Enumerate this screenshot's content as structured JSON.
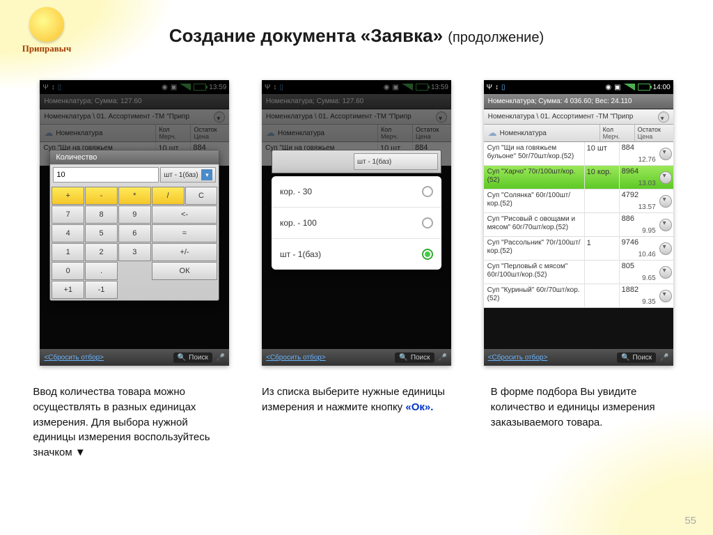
{
  "logo_text": "Приправыч",
  "title_main": "Создание документа «Заявка»",
  "title_cont": "(продолжение)",
  "pagenum": "55",
  "phone1": {
    "time": "13:59",
    "header": "Номенклатура; Сумма: 127.60",
    "breadcrumb": "Номенклатура \\ 01. Ассортимент -ТМ \"Припр",
    "tab_nom": "Номенклатура",
    "tab_kol": "Кол",
    "tab_merch": "Мерч.",
    "tab_ost": "Остаток",
    "tab_price": "Цена",
    "bg_row_name": "Суп \"Щи на говяжьем",
    "bg_row_kol": "10 шт",
    "bg_row_ost": "884",
    "dialog_title": "Количество",
    "input_value": "10",
    "select_label": "шт - 1(баз)",
    "calc_row_ops": [
      "+",
      "-",
      "*",
      "/",
      "C"
    ],
    "calc_r1": [
      "7",
      "8",
      "9",
      "<-"
    ],
    "calc_r2": [
      "4",
      "5",
      "6",
      "="
    ],
    "calc_r3": [
      "1",
      "2",
      "3",
      "+/-"
    ],
    "calc_r4": [
      "0",
      ".",
      "ОК"
    ],
    "calc_extra": [
      "+1",
      "-1"
    ]
  },
  "phone2": {
    "time": "13:59",
    "header": "Номенклатура; Сумма: 127.60",
    "breadcrumb": "Номенклатура \\ 01. Ассортимент -ТМ \"Припр",
    "options": [
      {
        "label": "кор. - 30",
        "sel": false
      },
      {
        "label": "кор. - 100",
        "sel": false
      },
      {
        "label": "шт - 1(баз)",
        "sel": true
      }
    ]
  },
  "phone3": {
    "time": "14:00",
    "header": "Номенклатура; Сумма: 4 036.60; Вес: 24.110",
    "breadcrumb": "Номенклатура \\ 01. Ассортимент -ТМ \"Припр",
    "tab_nom": "Номенклатура",
    "tab_kol": "Кол",
    "tab_merch": "Мерч.",
    "tab_ost": "Остаток",
    "tab_price": "Цена",
    "rows": [
      {
        "name": "Суп \"Щи на говяжьем бульоне\" 50г/70шт/кор.(52)",
        "kol": "10 шт",
        "ost": "884",
        "price": "12.76",
        "sel": false
      },
      {
        "name": "Суп \"Харчо\" 70г/100шт/кор.(52)",
        "kol": "10 кор.",
        "ost": "8964",
        "price": "13.03",
        "sel": true
      },
      {
        "name": "Суп \"Солянка\" 60г/100шт/кор.(52)",
        "kol": "",
        "ost": "4792",
        "price": "13.57",
        "sel": false
      },
      {
        "name": "Суп \"Рисовый с овощами и мясом\" 60г/70шт/кор.(52)",
        "kol": "",
        "ost": "886",
        "price": "9.95",
        "sel": false
      },
      {
        "name": "Суп \"Рассольник\" 70г/100шт/кор.(52)",
        "kol": "1",
        "ost": "9746",
        "price": "10.46",
        "sel": false
      },
      {
        "name": "Суп \"Перловый с мясом\" 60г/100шт/кор.(52)",
        "kol": "",
        "ost": "805",
        "price": "9.65",
        "sel": false
      },
      {
        "name": "Суп \"Куриный\" 60г/70шт/кор.(52)",
        "kol": "",
        "ost": "1882",
        "price": "9.35",
        "sel": false
      }
    ],
    "reset": "<Сбросить отбор>",
    "search": "Поиск"
  },
  "captions": {
    "c1": "Ввод количества товара можно осуществлять в разных единицах измерения. Для выбора нужной единицы измерения воспользуйтесь значком ▼",
    "c2_a": "Из списка выберите нужные единицы измерения и нажмите кнопку ",
    "c2_b": "«Ок».",
    "c3": "В форме подбора Вы увидите количество и единицы измерения заказываемого товара."
  },
  "footer": {
    "reset": "<Сбросить отбор>",
    "search": "Поиск"
  }
}
